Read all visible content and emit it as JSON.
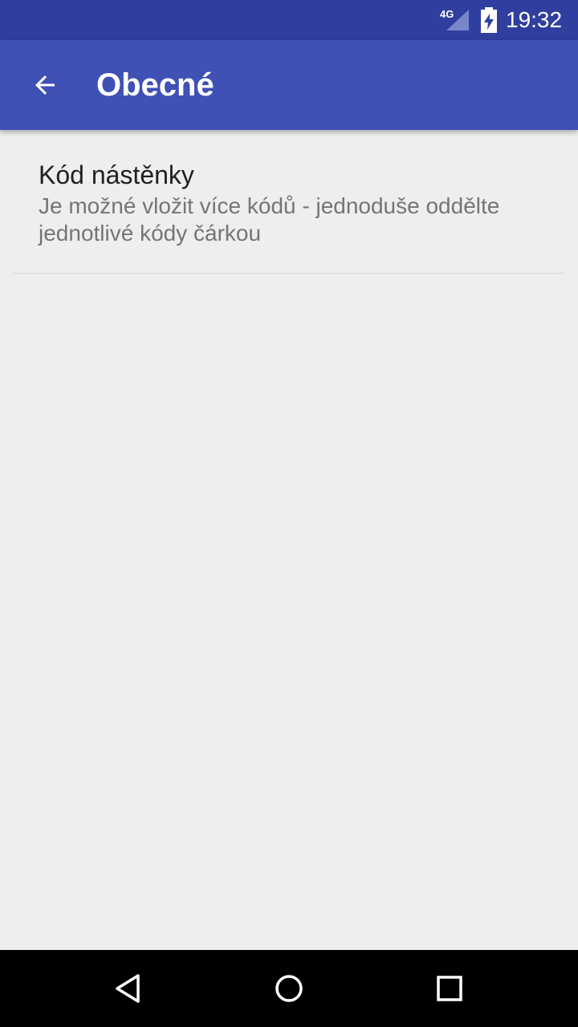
{
  "status_bar": {
    "network": "4G",
    "time": "19:32",
    "icons": [
      "signal-icon",
      "battery-charging-icon"
    ]
  },
  "toolbar": {
    "title": "Obecné",
    "back_icon": "arrow-back-icon"
  },
  "preferences": [
    {
      "title": "Kód nástěnky",
      "summary": "Je možné vložit více kódů - jednoduše oddělte jednotlivé kódy čárkou"
    }
  ],
  "nav_bar": {
    "icons": [
      "nav-back-icon",
      "nav-home-icon",
      "nav-recents-icon"
    ]
  },
  "colors": {
    "status_bar": "#303f9f",
    "toolbar": "#3f51b5",
    "background": "#eeeeee",
    "title_text": "#212121",
    "summary_text": "#757575"
  }
}
